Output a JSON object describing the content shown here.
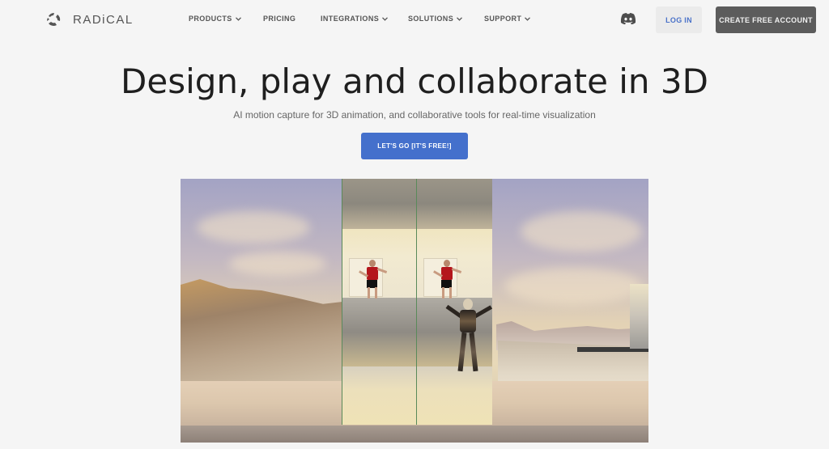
{
  "brand": {
    "name": "RADiCAL",
    "logo_icon": "radical-logo-icon"
  },
  "nav": {
    "items": [
      {
        "label": "PRODUCTS",
        "has_dropdown": true
      },
      {
        "label": "PRICING",
        "has_dropdown": false
      },
      {
        "label": "INTEGRATIONS",
        "has_dropdown": true
      },
      {
        "label": "SOLUTIONS",
        "has_dropdown": true
      },
      {
        "label": "SUPPORT",
        "has_dropdown": true
      }
    ],
    "discord_icon": "discord-icon",
    "login_label": "LOG IN",
    "create_account_label": "CREATE FREE ACCOUNT"
  },
  "hero": {
    "title": "Design, play and collaborate in 3D",
    "subtitle": "AI motion capture for 3D animation, and collaborative tools for real-time visualization",
    "cta_label": "LET'S GO [IT'S FREE!]"
  },
  "media": {
    "description": "3D scene with mirrored video panels of a dancer in a red shirt and an animated robot character in a desert landscape"
  },
  "colors": {
    "background": "#f5f5f5",
    "accent_blue": "#4470cc",
    "login_text": "#4a72c9",
    "dark_button": "#5c5c5c",
    "nav_text": "#555555",
    "title_text": "#1f1f1f"
  }
}
